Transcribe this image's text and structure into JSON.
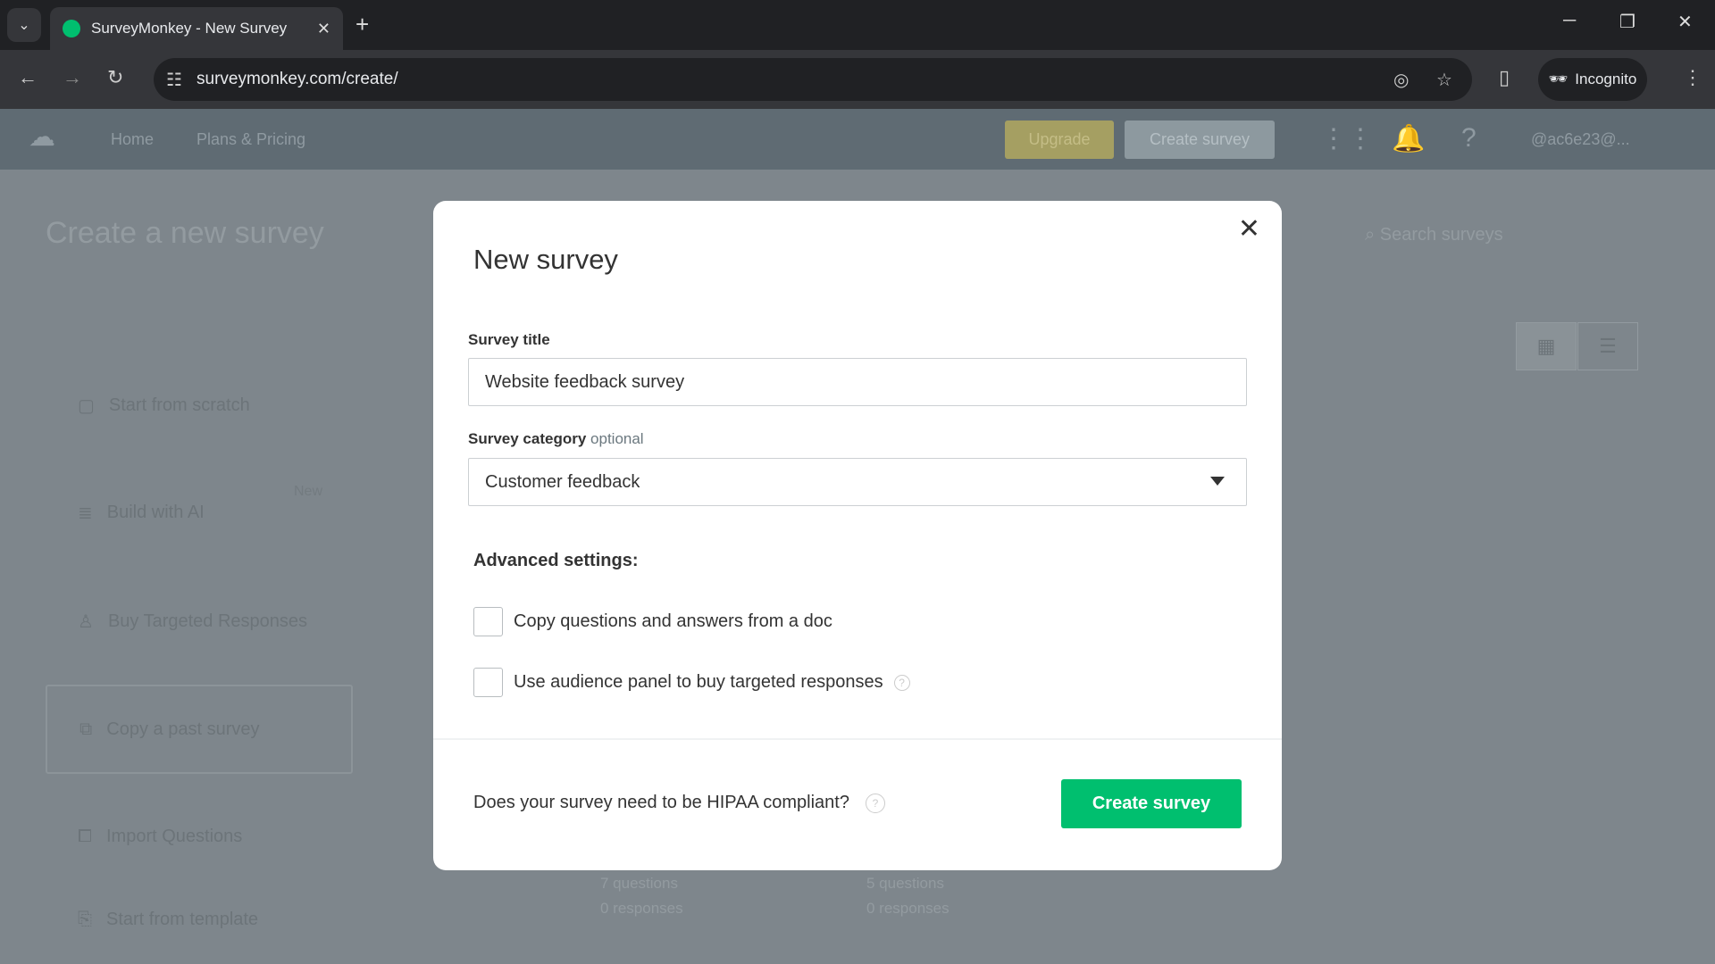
{
  "browser": {
    "tab_title": "SurveyMonkey - New Survey",
    "url": "surveymonkey.com/create/",
    "profile": "Incognito"
  },
  "sitenav": {
    "home": "Home",
    "plans": "Plans & Pricing",
    "upgrade": "Upgrade",
    "create_survey": "Create survey",
    "account": "@ac6e23@..."
  },
  "page": {
    "title": "Create a new survey",
    "search_placeholder": "Search surveys",
    "side_items": [
      {
        "label": "Start from scratch"
      },
      {
        "label": "Build with AI",
        "badge": "New"
      },
      {
        "label": "Buy Targeted Responses"
      },
      {
        "label": "Copy a past survey"
      },
      {
        "label": "Import Questions"
      },
      {
        "label": "Start from template"
      }
    ],
    "cards": [
      {
        "questions": "7 questions",
        "responses": "0 responses"
      },
      {
        "questions": "5 questions",
        "responses": "0 responses"
      }
    ]
  },
  "modal": {
    "title": "New survey",
    "survey_title_label": "Survey title",
    "survey_title_value": "Website feedback survey",
    "category_label": "Survey category",
    "category_optional": "optional",
    "category_value": "Customer feedback",
    "advanced_label": "Advanced settings:",
    "options": [
      {
        "label": "Copy questions and answers from a doc",
        "checked": false
      },
      {
        "label": "Use audience panel to buy targeted responses",
        "checked": false
      }
    ],
    "hipaa_text": "Does your survey need to be HIPAA compliant?",
    "create_button": "Create survey"
  },
  "colors": {
    "brand": "#00bf6f",
    "upgrade": "#f5e17a"
  }
}
